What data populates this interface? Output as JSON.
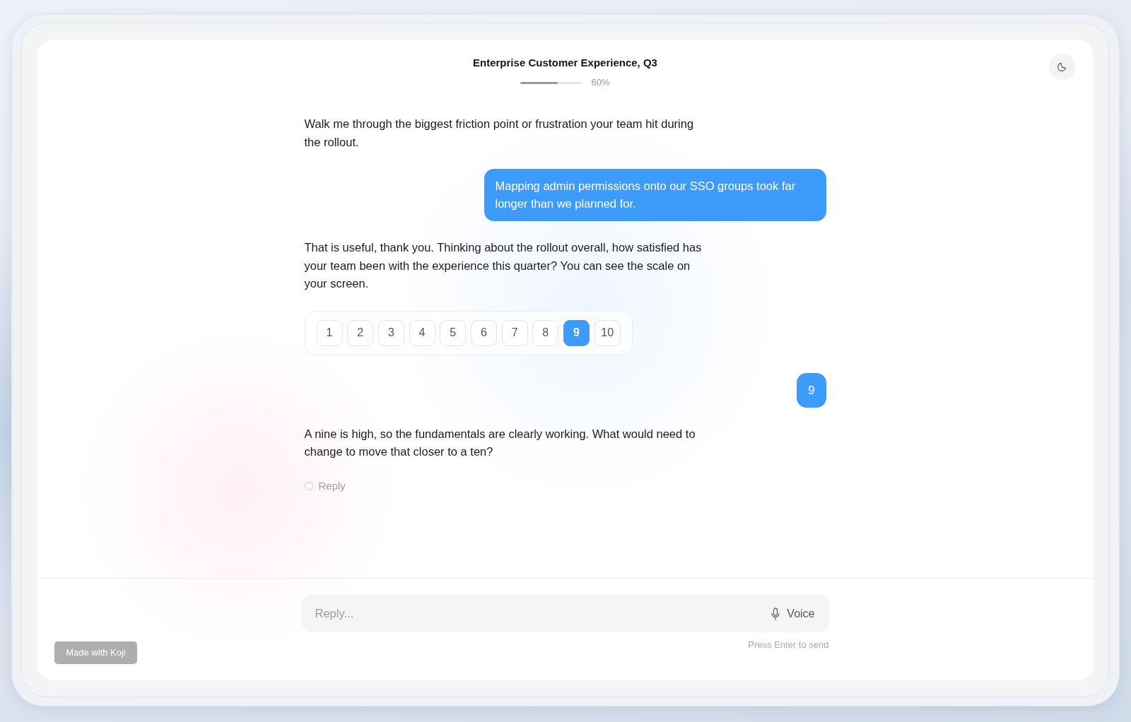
{
  "header": {
    "title": "Enterprise Customer Experience, Q3",
    "progress": {
      "level": 0.6,
      "label": "60%"
    }
  },
  "messages": [
    {
      "kind": "assistant",
      "text": "Walk me through the biggest friction point or frustration your team hit during the rollout."
    },
    {
      "kind": "user",
      "text": "Mapping admin permissions onto our SSO groups took far longer than we planned for."
    },
    {
      "kind": "assistant",
      "text": "That is useful, thank you. Thinking about the rollout overall, how satisfied has your team been with the experience this quarter? You can see the scale on your screen."
    },
    {
      "kind": "scale",
      "options": [
        {
          "label": "1",
          "selected": false
        },
        {
          "label": "2",
          "selected": false
        },
        {
          "label": "3",
          "selected": false
        },
        {
          "label": "4",
          "selected": false
        },
        {
          "label": "5",
          "selected": false
        },
        {
          "label": "6",
          "selected": false
        },
        {
          "label": "7",
          "selected": false
        },
        {
          "label": "8",
          "selected": false
        },
        {
          "label": "9",
          "selected": true
        },
        {
          "label": "10",
          "selected": false
        }
      ]
    },
    {
      "kind": "user",
      "text": "9"
    },
    {
      "kind": "assistant",
      "text": "A nine is high, so the fundamentals are clearly working. What would need to change to move that closer to a ten?"
    },
    {
      "kind": "reply_prompt",
      "label": "Reply",
      "selected": false
    }
  ],
  "composer": {
    "placeholder": "Reply...",
    "voice_label": "Voice",
    "hint": "Press Enter to send"
  },
  "attribution": {
    "label": "Made with Koji"
  }
}
